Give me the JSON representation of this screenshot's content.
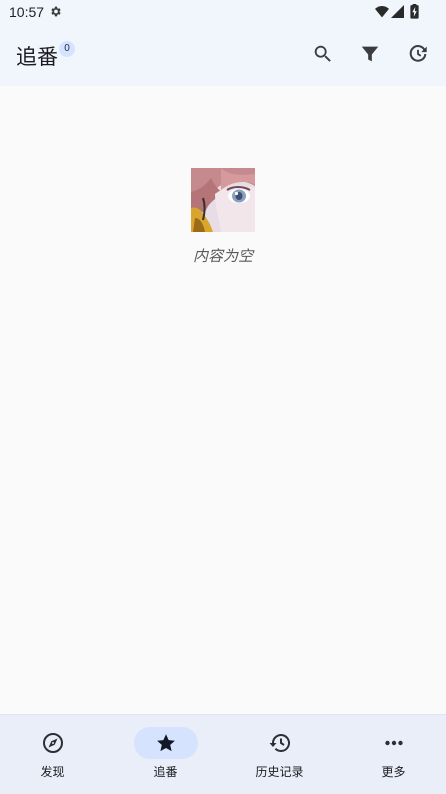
{
  "status_bar": {
    "time": "10:57",
    "icons": [
      "gear-icon",
      "wifi-icon",
      "signal-icon",
      "battery-icon"
    ]
  },
  "header": {
    "title": "追番",
    "badge_count": "0",
    "actions": [
      "search-icon",
      "filter-icon",
      "history-icon"
    ]
  },
  "empty_state": {
    "text": "内容为空",
    "image": "anime-girl-illustration"
  },
  "bottom_nav": {
    "items": [
      {
        "label": "发现",
        "icon": "compass-icon",
        "active": false
      },
      {
        "label": "追番",
        "icon": "star-icon",
        "active": true
      },
      {
        "label": "历史记录",
        "icon": "history-icon",
        "active": false
      },
      {
        "label": "更多",
        "icon": "more-icon",
        "active": false
      }
    ]
  },
  "colors": {
    "bar_background": "#f1f6fd",
    "page_background": "#fafafa",
    "active_indicator": "#d6e3ff",
    "nav_background": "#e9eef8"
  }
}
